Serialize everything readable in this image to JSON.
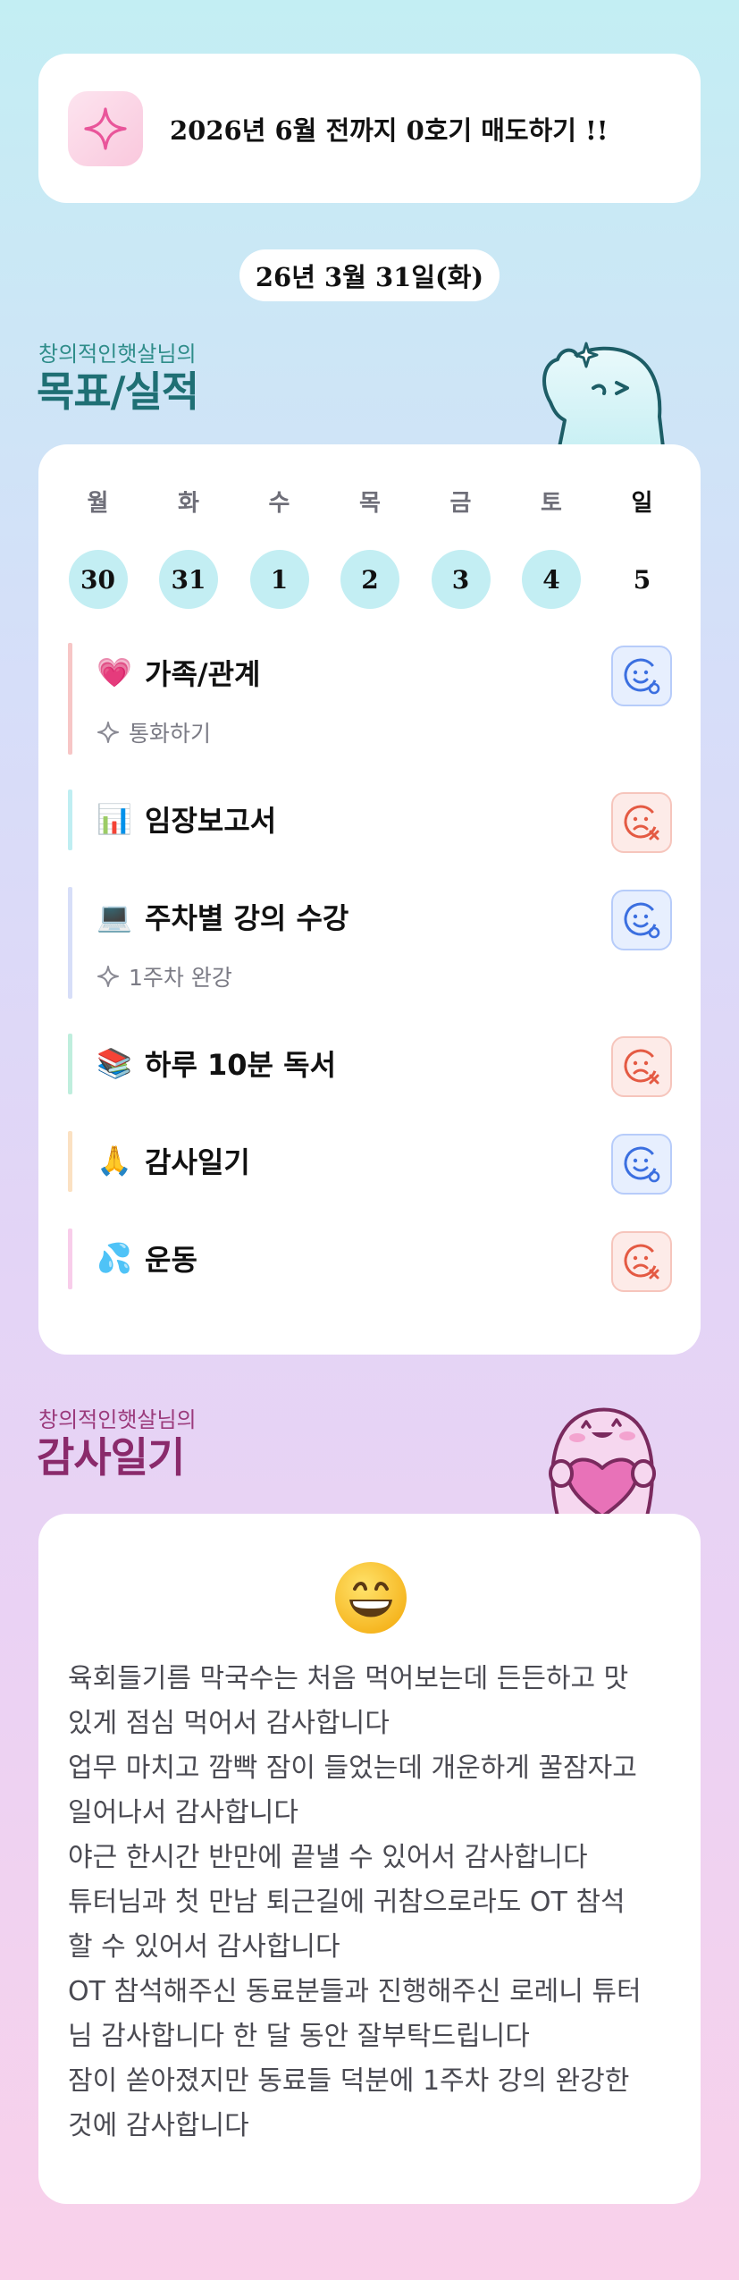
{
  "goal_banner": {
    "icon": "sparkle-icon",
    "text": "2026년 6월 전까지 0호기 매도하기 !!"
  },
  "date_label": "26년 3월 31일(화)",
  "goals_section": {
    "subtitle": "창의적인햇살님의",
    "title": "목표/실적"
  },
  "week": [
    {
      "day": "월",
      "date": "30"
    },
    {
      "day": "화",
      "date": "31"
    },
    {
      "day": "수",
      "date": "1"
    },
    {
      "day": "목",
      "date": "2"
    },
    {
      "day": "금",
      "date": "3"
    },
    {
      "day": "토",
      "date": "4"
    },
    {
      "day": "일",
      "date": "5"
    }
  ],
  "goals": [
    {
      "emoji": "💗",
      "name": "가족/관계",
      "note": "통화하기",
      "status": "done",
      "bar_color": "#f7c6c6"
    },
    {
      "emoji": "📊",
      "name": "임장보고서",
      "note": "",
      "status": "missed",
      "bar_color": "#bfeef2"
    },
    {
      "emoji": "💻",
      "name": "주차별 강의 수강",
      "note": "1주차 완강",
      "status": "done",
      "bar_color": "#d7def8"
    },
    {
      "emoji": "📚",
      "name": "하루 10분 독서",
      "note": "",
      "status": "missed",
      "bar_color": "#bfeedd"
    },
    {
      "emoji": "🙏",
      "name": "감사일기",
      "note": "",
      "status": "done",
      "bar_color": "#fbe1c2"
    },
    {
      "emoji": "💦",
      "name": "운동",
      "note": "",
      "status": "missed",
      "bar_color": "#f8cdea"
    }
  ],
  "colors": {
    "good": "#3b6fe0",
    "bad": "#e45a43",
    "accent": "#c3eef3"
  },
  "thanks_section": {
    "subtitle": "창의적인햇살님의",
    "title": "감사일기"
  },
  "thanks": {
    "emoji": "grin-face-icon",
    "lines": [
      "육회들기름 막국수는 처음 먹어보는데 든든하고 맛",
      "있게 점심 먹어서 감사합니다",
      "업무 마치고 깜빡 잠이 들었는데 개운하게 꿀잠자고",
      "일어나서 감사합니다",
      "야근 한시간 반만에 끝낼 수 있어서 감사합니다",
      "튜터님과 첫 만남 퇴근길에 귀참으로라도 OT 참석",
      "할 수 있어서 감사합니다",
      "OT 참석해주신 동료분들과 진행해주신 로레니 튜터",
      "님 감사합니다 한 달 동안 잘부탁드립니다",
      "잠이 쏟아졌지만 동료들 덕분에 1주차 강의 완강한",
      "것에 감사합니다"
    ]
  }
}
